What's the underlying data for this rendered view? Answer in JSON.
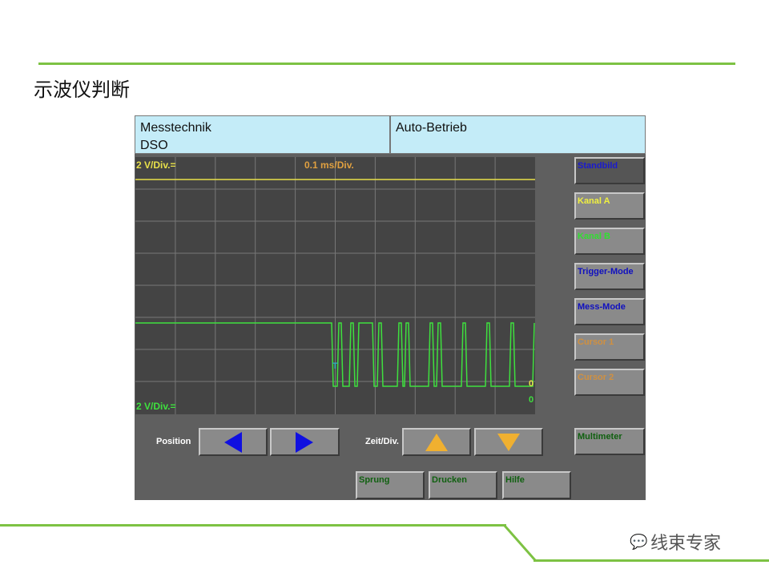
{
  "slide_title": "示波仪判断",
  "header": {
    "left_line1": "Messtechnik",
    "left_line2": "DSO",
    "right": "Auto-Betrieb"
  },
  "scope": {
    "ch_a_scale": "2 V/Div.=",
    "time_scale": "0.1 ms/Div.",
    "ch_b_scale": "2 V/Div.=",
    "trigger_marker": "T",
    "ch_a_zero": "0",
    "ch_b_zero": "0"
  },
  "side_buttons": [
    "Standbild",
    "Kanal A",
    "Kanal B",
    "Trigger-Mode",
    "Mess-Mode",
    "Cursor 1",
    "Cursor 2"
  ],
  "multimeter": "Multimeter",
  "position_label": "Position",
  "zeit_label": "Zeit/Div.",
  "bottom_buttons": [
    "Sprung",
    "Drucken",
    "Hilfe"
  ],
  "watermark": "线束专家",
  "colors": {
    "accent": "#7dc243",
    "ch_a": "#e8e04a",
    "ch_b": "#3ee03e",
    "blue": "#1010d0",
    "orange": "#e8a030"
  }
}
